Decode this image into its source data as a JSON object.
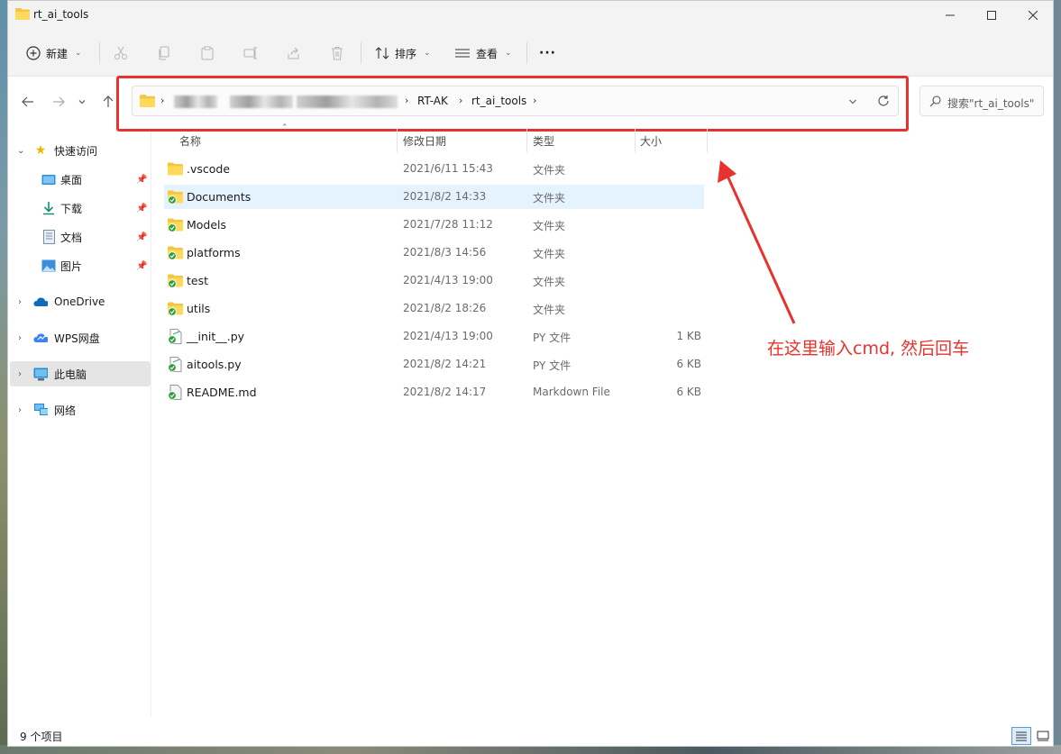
{
  "window": {
    "title": "rt_ai_tools"
  },
  "toolbar": {
    "new_label": "新建",
    "sort_label": "排序",
    "view_label": "查看",
    "more_label": "···",
    "icons": [
      "cut-icon",
      "copy-icon",
      "paste-icon",
      "rename-icon",
      "share-icon",
      "delete-icon"
    ]
  },
  "address": {
    "crumbs": [
      "RT-AK",
      "rt_ai_tools"
    ]
  },
  "search": {
    "placeholder": "搜索\"rt_ai_tools\""
  },
  "sidebar": {
    "quick_access": "快速访问",
    "pinned": [
      {
        "label": "桌面",
        "icon": "desktop-icon"
      },
      {
        "label": "下载",
        "icon": "download-icon"
      },
      {
        "label": "文档",
        "icon": "documents-icon"
      },
      {
        "label": "图片",
        "icon": "pictures-icon"
      }
    ],
    "onedrive": "OneDrive",
    "wps": "WPS网盘",
    "this_pc": "此电脑",
    "network": "网络"
  },
  "columns": {
    "name": "名称",
    "date": "修改日期",
    "type": "类型",
    "size": "大小"
  },
  "files": [
    {
      "name": ".vscode",
      "date": "2021/6/11 15:43",
      "type": "文件夹",
      "size": "",
      "kind": "folder"
    },
    {
      "name": "Documents",
      "date": "2021/8/2 14:33",
      "type": "文件夹",
      "size": "",
      "kind": "folder-synced"
    },
    {
      "name": "Models",
      "date": "2021/7/28 11:12",
      "type": "文件夹",
      "size": "",
      "kind": "folder-synced"
    },
    {
      "name": "platforms",
      "date": "2021/8/3 14:56",
      "type": "文件夹",
      "size": "",
      "kind": "folder-synced"
    },
    {
      "name": "test",
      "date": "2021/4/13 19:00",
      "type": "文件夹",
      "size": "",
      "kind": "folder-synced"
    },
    {
      "name": "utils",
      "date": "2021/8/2 18:26",
      "type": "文件夹",
      "size": "",
      "kind": "folder-synced"
    },
    {
      "name": "__init__.py",
      "date": "2021/4/13 19:00",
      "type": "PY 文件",
      "size": "1 KB",
      "kind": "file-synced"
    },
    {
      "name": "aitools.py",
      "date": "2021/8/2 14:21",
      "type": "PY 文件",
      "size": "6 KB",
      "kind": "file-synced"
    },
    {
      "name": "README.md",
      "date": "2021/8/2 14:17",
      "type": "Markdown File",
      "size": "6 KB",
      "kind": "file-synced-gray"
    }
  ],
  "status": {
    "item_count": "9 个项目"
  },
  "annotation": {
    "text": "在这里输入cmd, 然后回车",
    "color": "#e8322d"
  }
}
